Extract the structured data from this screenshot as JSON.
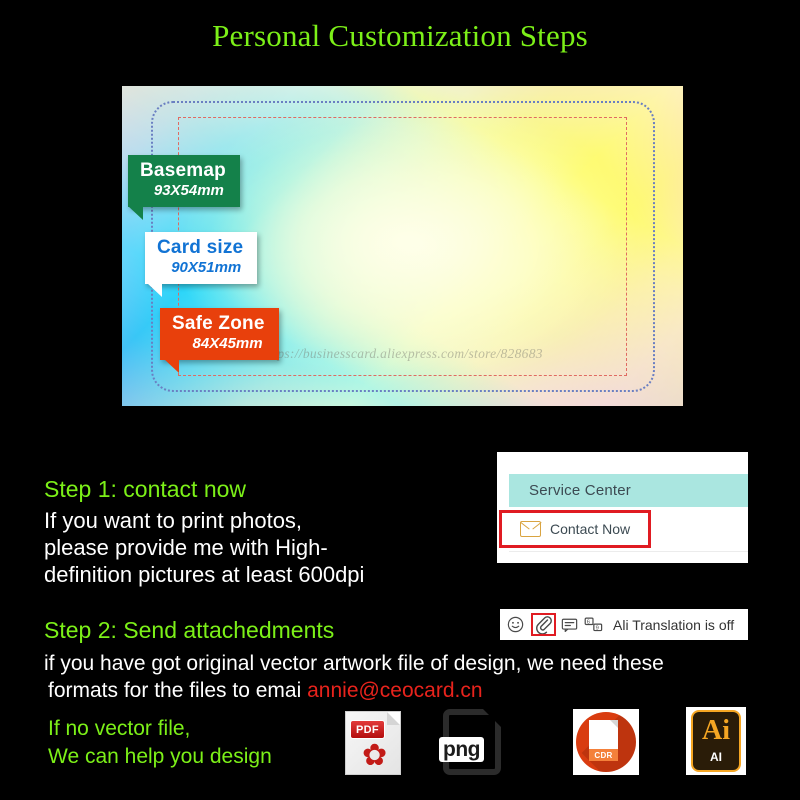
{
  "page": {
    "title": "Personal Customization Steps",
    "background_color": "#000000",
    "accent_green": "#7cf018",
    "accent_red": "#e8231c"
  },
  "card_preview": {
    "watermark": "https://businesscard.aliexpress.com/store/828683",
    "callouts": [
      {
        "name": "basemap",
        "title": "Basemap",
        "dimensions": "93X54mm",
        "background_color": "#14814a",
        "text_color": "#ffffff"
      },
      {
        "name": "card-size",
        "title": "Card size",
        "dimensions": "90X51mm",
        "background_color": "#ffffff",
        "text_color": "#1173d4"
      },
      {
        "name": "safe-zone",
        "title": "Safe Zone",
        "dimensions": "84X45mm",
        "background_color": "#e8400c",
        "text_color": "#ffffff"
      }
    ],
    "boundaries": {
      "card_size_border_color": "#6a7fc2",
      "safe_zone_border_color": "#e06a62"
    }
  },
  "steps": {
    "step1": {
      "heading": "Step 1: contact now",
      "lines": [
        "If you want to print photos,",
        "please provide me with High-",
        "definition pictures  at least 600dpi"
      ]
    },
    "step2": {
      "heading": "Step 2: Send attachedments",
      "line1": "if you have got original vector artwork file of design, we need these",
      "line2_prefix": "formats for the files to emai ",
      "email": "annie@ceocard.cn"
    },
    "no_vector": {
      "line1": "If no vector file,",
      "line2": "We can help you design"
    }
  },
  "service_center": {
    "header_title": "Service Center",
    "header_color": "#aae6e0",
    "contact_now_label": "Contact Now",
    "contact_now_icon": "envelope-icon",
    "highlight_color": "#e01b22"
  },
  "translation_bar": {
    "status_text": "Ali Translation is off",
    "icons": [
      "smiley-icon",
      "paperclip-icon",
      "chat-bubble-icon",
      "translate-icon"
    ],
    "highlighted_icon": "paperclip-icon",
    "highlight_color": "#e01b22"
  },
  "file_formats": [
    {
      "name": "pdf",
      "badge": "PDF"
    },
    {
      "name": "png",
      "label": "png"
    },
    {
      "name": "cdr",
      "label": "CDR"
    },
    {
      "name": "ai",
      "glyph": "Ai",
      "label": "AI"
    }
  ]
}
